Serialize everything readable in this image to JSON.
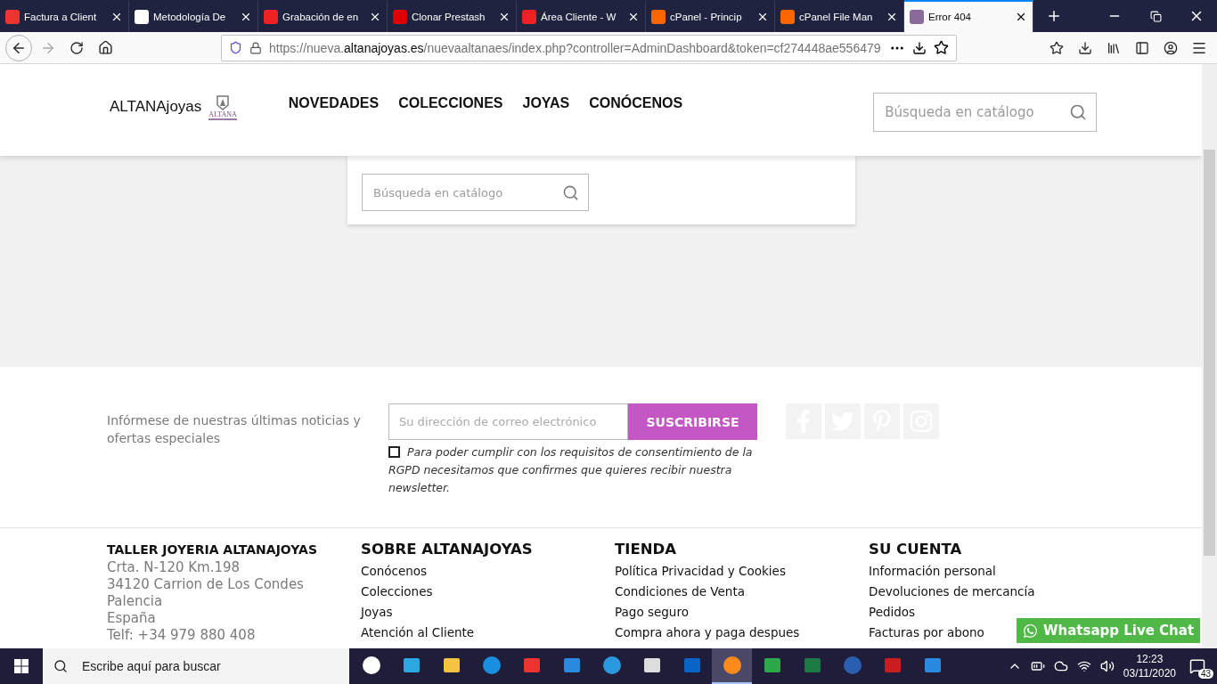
{
  "browser": {
    "tabs": [
      {
        "title": "Factura a Client",
        "selected": false
      },
      {
        "title": "Metodología De",
        "selected": false
      },
      {
        "title": "Grabación de en",
        "selected": false
      },
      {
        "title": "Clonar Prestash",
        "selected": false
      },
      {
        "title": "Área Cliente - W",
        "selected": false
      },
      {
        "title": "cPanel - Princip",
        "selected": false
      },
      {
        "title": "cPanel File Man",
        "selected": false
      },
      {
        "title": "Error 404",
        "selected": true
      }
    ],
    "url": {
      "scheme_sub": "https://nueva.",
      "domain": "altanajoyas.es",
      "path": "/nuevaaltanaes/index.php?controller=AdminDashboard&token=cf274448ae556479"
    }
  },
  "header": {
    "logo": "ALTANAjoyas",
    "logo_mark": "ALTANA",
    "nav": [
      "NOVEDADES",
      "COLECCIONES",
      "JOYAS",
      "CONÓCENOS"
    ],
    "search": {
      "placeholder": "Búsqueda en catálogo"
    }
  },
  "content": {
    "search": {
      "placeholder": "Búsqueda en catálogo"
    }
  },
  "newsletter": {
    "text": "Infórmese de nuestras últimas noticias y ofertas especiales",
    "email": {
      "placeholder": "Su dirección de correo electrónico"
    },
    "button": "SUSCRIBIRSE",
    "consent": {
      "checked": false,
      "text": "Para poder cumplir con los requisitos de consentimiento de la RGPD necesitamos que confirmes que quieres recibir nuestra newsletter."
    }
  },
  "footer": {
    "columns": [
      {
        "kind": "address",
        "title": "TALLER JOYERIA ALTANAJOYAS",
        "lines": [
          "Crta. N-120 Km.198",
          "34120 Carrion de Los Condes",
          "Palencia",
          "España",
          "Telf: +34 979 880 408"
        ]
      },
      {
        "kind": "links",
        "title": "SOBRE ALTANAJOYAS",
        "lines": [
          "Conócenos",
          "Colecciones",
          "Joyas",
          "Atención al Cliente"
        ]
      },
      {
        "kind": "links",
        "title": "TIENDA",
        "lines": [
          "Política Privacidad y Cookies",
          "Condiciones de Venta",
          "Pago seguro",
          "Compra ahora y paga despues"
        ]
      },
      {
        "kind": "links",
        "title": "SU CUENTA",
        "lines": [
          "Información personal",
          "Devoluciones de mercancía",
          "Pedidos",
          "Facturas por abono"
        ]
      }
    ]
  },
  "chat_button": "Whatsapp Live Chat",
  "taskbar": {
    "search": {
      "placeholder": "Escribe aquí para buscar"
    },
    "apps": [
      {
        "selected": false
      },
      {
        "selected": false
      },
      {
        "selected": false
      },
      {
        "selected": false
      },
      {
        "selected": false
      },
      {
        "selected": false
      },
      {
        "selected": false
      },
      {
        "selected": false
      },
      {
        "selected": false
      },
      {
        "selected": true
      },
      {
        "selected": false
      },
      {
        "selected": false
      },
      {
        "selected": false
      },
      {
        "selected": false
      },
      {
        "selected": false
      }
    ],
    "time": "12:23",
    "date": "03/11/2020",
    "notifications": "43"
  }
}
